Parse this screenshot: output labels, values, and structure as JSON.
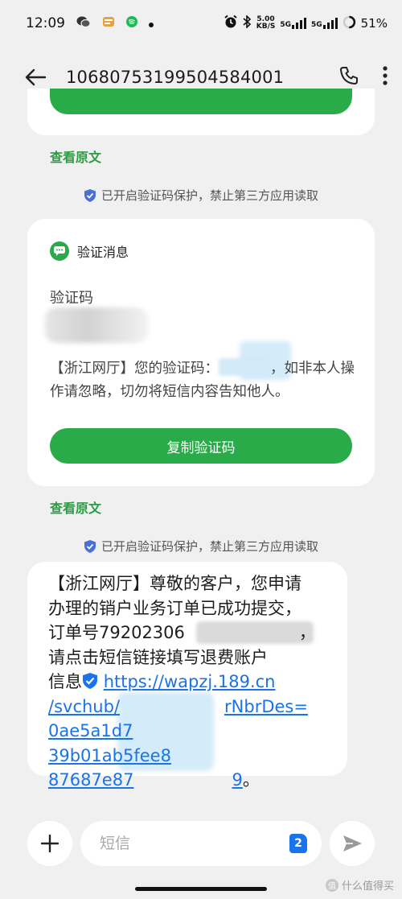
{
  "status_bar": {
    "time": "12:09",
    "net_speed_value": "5.00",
    "net_speed_unit": "KB/S",
    "signal_label_1": "5G",
    "signal_label_2": "5G",
    "battery": "51%"
  },
  "app_bar": {
    "title": "1068075319950458400​1"
  },
  "thread": {
    "view_original_1": "查看原文",
    "protect_note_1": "已开启验证码保护，禁止第三方应用读取",
    "verify_card": {
      "header": "验证消息",
      "code_label": "验证码",
      "message_part1": "【浙江网厅】您的验证码：",
      "message_part2": "，如非本人操作请忽略，切勿将短信内容告知他人。",
      "copy_button": "复制验证码"
    },
    "view_original_2": "查看原文",
    "protect_note_2": "已开启验证码保护，禁止第三方应用读取",
    "message": {
      "line1": "【浙江网厅】尊敬的客户，您申请",
      "line2": "办理的销户业务订单已成功提交，",
      "line3_prefix": "订单号79202306",
      "line3_suffix": "，",
      "line4": "请点击短信链接填写退费账户",
      "line5_prefix": "信息",
      "link_line1": "https://wapzj.189.cn",
      "link_line2": "/svchub/",
      "link_line2_tail": "rNbrDes=",
      "link_line3": "0ae5a1d7",
      "link_line3_tail": "39b01ab5fee8",
      "link_line4": "87687e87",
      "link_line4_tail": "9",
      "end_mark": "。"
    }
  },
  "composer": {
    "placeholder": "短信",
    "sim_slot": "2"
  },
  "watermark": {
    "badge": "值",
    "text": "什么值得买"
  },
  "colors": {
    "accent_green": "#2aab4a",
    "link_blue": "#1a73e8",
    "background": "#f0f0f0"
  }
}
